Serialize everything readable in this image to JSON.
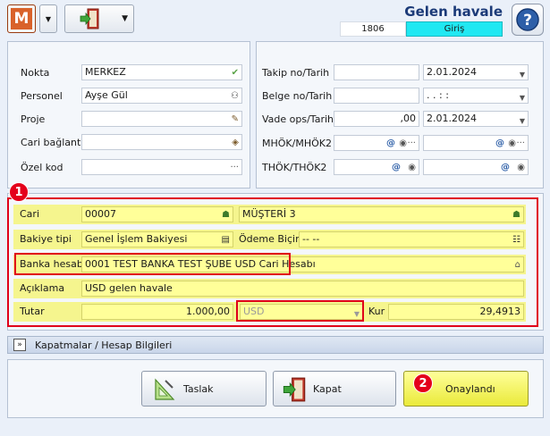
{
  "toolbar": {
    "logo_letter": "M",
    "title": "Gelen havale",
    "doc_number": "1806",
    "status": "Giriş",
    "status_color": "#20e8f2"
  },
  "left_panel": {
    "nokta_label": "Nokta",
    "nokta_value": "MERKEZ",
    "personel_label": "Personel",
    "personel_value": "Ayşe Gül",
    "proje_label": "Proje",
    "proje_value": "",
    "cari_baglanti_label": "Cari bağlantı",
    "cari_baglanti_value": "",
    "ozel_kod_label": "Özel kod",
    "ozel_kod_value": "",
    "ellipsis": "···"
  },
  "right_panel": {
    "takip_label": "Takip no/Tarih",
    "takip_no": "",
    "takip_tarih": "2.01.2024",
    "belge_label": "Belge no/Tarih",
    "belge_no": "",
    "belge_tarih": ".   .        :   :",
    "vade_label": "Vade ops/Tarih",
    "vade_ops": ",00",
    "vade_tarih": "2.01.2024",
    "mhok_label": "MHÖK/MHÖK2",
    "thok_label": "THÖK/THÖK2",
    "at_symbol": "@"
  },
  "main": {
    "cari_label": "Cari",
    "cari_code": "00007",
    "cari_name": "MÜŞTERİ 3",
    "bakiye_label": "Bakiye tipi",
    "bakiye_value": "Genel İşlem Bakiyesi",
    "odeme_label": "Ödeme Biçimi",
    "odeme_value": "-- --",
    "banka_label": "Banka hesabı",
    "banka_value": "0001 TEST BANKA TEST ŞUBE USD Cari Hesabı",
    "aciklama_label": "Açıklama",
    "aciklama_value": "USD gelen havale",
    "tutar_label": "Tutar",
    "tutar_value": "1.000,00",
    "currency": "USD",
    "kur_label": "Kur",
    "kur_value": "29,4913"
  },
  "badges": {
    "one": "1",
    "two": "2"
  },
  "kapatmalar_label": "Kapatmalar / Hesap Bilgileri",
  "buttons": {
    "taslak": "Taslak",
    "kapat": "Kapat",
    "onaylandi": "Onaylandı"
  }
}
